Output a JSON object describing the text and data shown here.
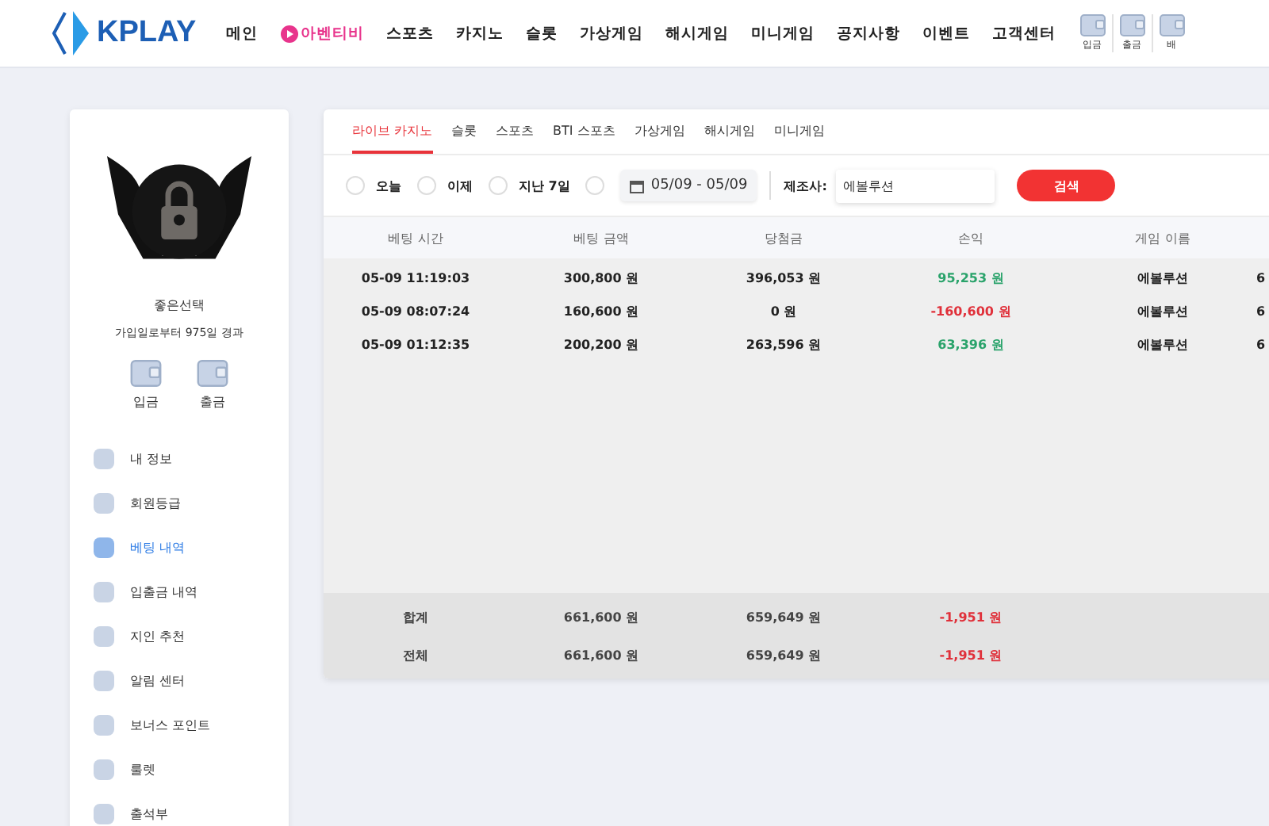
{
  "header": {
    "logo": "KPLAY",
    "nav": [
      {
        "label": "메인",
        "kind": "plain"
      },
      {
        "label": "아벤티비",
        "kind": "live"
      },
      {
        "label": "스포츠",
        "kind": "plain"
      },
      {
        "label": "카지노",
        "kind": "plain"
      },
      {
        "label": "슬롯",
        "kind": "plain"
      },
      {
        "label": "가상게임",
        "kind": "plain"
      },
      {
        "label": "해시게임",
        "kind": "plain"
      },
      {
        "label": "미니게임",
        "kind": "plain"
      },
      {
        "label": "공지사항",
        "kind": "plain"
      },
      {
        "label": "이벤트",
        "kind": "plain"
      },
      {
        "label": "고객센터",
        "kind": "plain"
      }
    ],
    "quick": [
      "입금",
      "출금",
      "배"
    ]
  },
  "profile": {
    "name": "좋은선택",
    "since": "가입일로부터 975일 경과",
    "actions": [
      "입금",
      "출금"
    ]
  },
  "sidebar": {
    "items": [
      {
        "label": "내 정보",
        "selected": false
      },
      {
        "label": "회원등급",
        "selected": false
      },
      {
        "label": "베팅 내역",
        "selected": true
      },
      {
        "label": "입출금 내역",
        "selected": false
      },
      {
        "label": "지인 추천",
        "selected": false
      },
      {
        "label": "알림 센터",
        "selected": false
      },
      {
        "label": "보너스 포인트",
        "selected": false
      },
      {
        "label": "룰렛",
        "selected": false
      },
      {
        "label": "출석부",
        "selected": false
      }
    ]
  },
  "tabs": [
    {
      "label": "라이브 카지노",
      "selected": true
    },
    {
      "label": "슬롯",
      "selected": false
    },
    {
      "label": "스포츠",
      "selected": false
    },
    {
      "label": "BTI 스포츠",
      "selected": false
    },
    {
      "label": "가상게임",
      "selected": false
    },
    {
      "label": "해시게임",
      "selected": false
    },
    {
      "label": "미니게임",
      "selected": false
    }
  ],
  "filters": {
    "periods": [
      {
        "label": "오늘",
        "selected": false
      },
      {
        "label": "이제",
        "selected": false
      },
      {
        "label": "지난 7일",
        "selected": false
      },
      {
        "selected": false
      }
    ],
    "date_range": "05/09 - 05/09",
    "provider_label": "제조사:",
    "provider": "에볼루션",
    "search_button": "검색"
  },
  "table": {
    "columns": [
      "베팅 시간",
      "베팅 금액",
      "당첨금",
      "손익",
      "게임 이름"
    ],
    "rows": [
      {
        "cells": [
          "05-09 11:19:03",
          "300,800 원",
          "396,053 원",
          "95,253 원",
          "에볼루션",
          "6"
        ],
        "color": "#2aa36b"
      },
      {
        "cells": [
          "05-09 08:07:24",
          "160,600 원",
          "0 원",
          "-160,600 원",
          "에볼루션",
          "6"
        ],
        "color": "#e0303a"
      },
      {
        "cells": [
          "05-09 01:12:35",
          "200,200 원",
          "263,596 원",
          "63,396 원",
          "에볼루션",
          "6"
        ],
        "color": "#2aa36b"
      }
    ],
    "totals": [
      {
        "cells": [
          "합계",
          "661,600 원",
          "659,649 원",
          "-1,951 원"
        ],
        "color": "#e0303a"
      },
      {
        "cells": [
          "전체",
          "661,600 원",
          "659,649 원",
          "-1,951 원"
        ],
        "color": "#e0303a"
      }
    ]
  }
}
